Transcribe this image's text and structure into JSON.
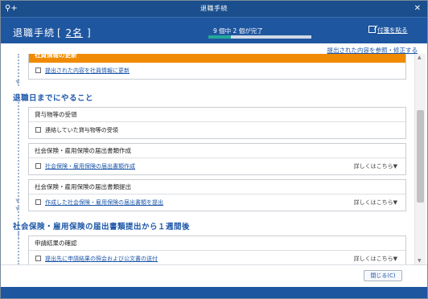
{
  "window": {
    "title": "退職手続",
    "close_glyph": "✕"
  },
  "header": {
    "title": "退職手続",
    "count_open": "[",
    "count_value": "2名",
    "count_close": "]",
    "progress_text": "9 個中 2 個が完了",
    "progress_done": 2,
    "progress_total": 9,
    "sticky_label": "付箋を貼る",
    "accent_color": "#1e56a0",
    "progress_color": "#24a89a"
  },
  "view_link": "提出された内容を参照・修正する",
  "cards_top": {
    "partial_title": "社員情報の更新",
    "task": "提出された内容を社員情報に更新"
  },
  "sections": [
    {
      "title": "退職日までにやること",
      "cards": [
        {
          "title": "貸与物等の受領",
          "task": "連絡していた貸与物等の受領",
          "task_is_link": false,
          "detail": ""
        },
        {
          "title": "社会保険・雇用保険の届出書類作成",
          "task": "社会保険・雇用保険の届出書類作成",
          "task_is_link": true,
          "detail": "詳しくはこちら▼"
        },
        {
          "title": "社会保険・雇用保険の届出書類提出",
          "task": "作成した社会保険・雇用保険の届出書類を提出",
          "task_is_link": true,
          "detail": "詳しくはこちら▼"
        }
      ]
    },
    {
      "title": "社会保険・雇用保険の届出書類提出から１週間後",
      "cards": [
        {
          "title": "申請結果の確認",
          "task": "提出先に申請結果の照会および公文書の送付",
          "task_is_link": true,
          "detail": "詳しくはこちら▼"
        }
      ]
    }
  ],
  "footer": {
    "close_label": "閉じる(C)"
  }
}
